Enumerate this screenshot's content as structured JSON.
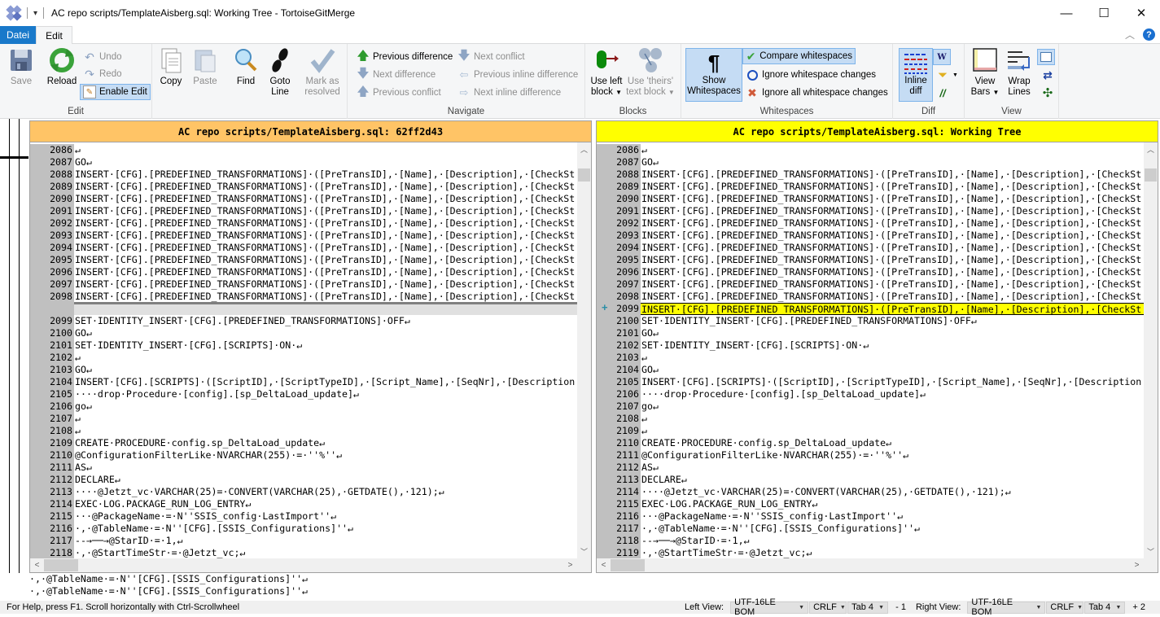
{
  "window": {
    "title": "AC repo scripts/TemplateAisberg.sql: Working Tree - TortoiseGitMerge",
    "controls": {
      "minimize": "—",
      "maximize": "☐",
      "close": "✕"
    }
  },
  "ribbon_tabs": [
    {
      "label": "Datei",
      "active": false
    },
    {
      "label": "Edit",
      "active": true
    }
  ],
  "ribbon": {
    "edit_group": {
      "label": "Edit",
      "save": "Save",
      "reload": "Reload",
      "undo": "Undo",
      "redo": "Redo",
      "enable_edit": "Enable Edit",
      "copy": "Copy",
      "paste": "Paste",
      "find": "Find",
      "goto_line_1": "Goto",
      "goto_line_2": "Line",
      "mark_resolved_1": "Mark as",
      "mark_resolved_2": "resolved"
    },
    "navigate_group": {
      "label": "Navigate",
      "previous_difference": "Previous difference",
      "next_difference": "Next difference",
      "previous_conflict": "Previous conflict",
      "next_conflict": "Next conflict",
      "previous_inline_difference": "Previous inline difference",
      "next_inline_difference": "Next inline difference"
    },
    "blocks_group": {
      "label": "Blocks",
      "use_left_1": "Use left",
      "use_left_2": "block",
      "use_theirs_1": "Use 'theirs'",
      "use_theirs_2": "text block"
    },
    "whitespaces_group": {
      "label": "Whitespaces",
      "show_whitespaces_1": "Show",
      "show_whitespaces_2": "Whitespaces",
      "compare_whitespaces": "Compare whitespaces",
      "ignore_whitespace_changes": "Ignore whitespace changes",
      "ignore_all_whitespace_changes": "Ignore all whitespace changes"
    },
    "diff_group": {
      "label": "Diff",
      "inline_diff_1": "Inline",
      "inline_diff_2": "diff"
    },
    "view_group": {
      "label": "View",
      "view_bars_1": "View",
      "view_bars_2": "Bars",
      "wrap_lines_1": "Wrap",
      "wrap_lines_2": "Lines"
    }
  },
  "left_pane": {
    "header": "AC repo scripts/TemplateAisberg.sql: 62ff2d43",
    "lines": [
      {
        "n": "2086",
        "t": "↵",
        "k": ""
      },
      {
        "n": "2087",
        "t": "GO↵",
        "k": ""
      },
      {
        "n": "2088",
        "t": "INSERT·[CFG].[PREDEFINED_TRANSFORMATIONS]·([PreTransID],·[Name],·[Description],·[CheckSt",
        "k": ""
      },
      {
        "n": "2089",
        "t": "INSERT·[CFG].[PREDEFINED_TRANSFORMATIONS]·([PreTransID],·[Name],·[Description],·[CheckSt",
        "k": ""
      },
      {
        "n": "2090",
        "t": "INSERT·[CFG].[PREDEFINED_TRANSFORMATIONS]·([PreTransID],·[Name],·[Description],·[CheckSt",
        "k": ""
      },
      {
        "n": "2091",
        "t": "INSERT·[CFG].[PREDEFINED_TRANSFORMATIONS]·([PreTransID],·[Name],·[Description],·[CheckSt",
        "k": ""
      },
      {
        "n": "2092",
        "t": "INSERT·[CFG].[PREDEFINED_TRANSFORMATIONS]·([PreTransID],·[Name],·[Description],·[CheckSt",
        "k": ""
      },
      {
        "n": "2093",
        "t": "INSERT·[CFG].[PREDEFINED_TRANSFORMATIONS]·([PreTransID],·[Name],·[Description],·[CheckSt",
        "k": ""
      },
      {
        "n": "2094",
        "t": "INSERT·[CFG].[PREDEFINED_TRANSFORMATIONS]·([PreTransID],·[Name],·[Description],·[CheckSt",
        "k": ""
      },
      {
        "n": "2095",
        "t": "INSERT·[CFG].[PREDEFINED_TRANSFORMATIONS]·([PreTransID],·[Name],·[Description],·[CheckSt",
        "k": ""
      },
      {
        "n": "2096",
        "t": "INSERT·[CFG].[PREDEFINED_TRANSFORMATIONS]·([PreTransID],·[Name],·[Description],·[CheckSt",
        "k": ""
      },
      {
        "n": "2097",
        "t": "INSERT·[CFG].[PREDEFINED_TRANSFORMATIONS]·([PreTransID],·[Name],·[Description],·[CheckSt",
        "k": ""
      },
      {
        "n": "2098",
        "t": "INSERT·[CFG].[PREDEFINED_TRANSFORMATIONS]·([PreTransID],·[Name],·[Description],·[CheckSt",
        "k": "underlined"
      },
      {
        "n": "",
        "t": "",
        "k": "ghost"
      },
      {
        "n": "2099",
        "t": "SET·IDENTITY_INSERT·[CFG].[PREDEFINED_TRANSFORMATIONS]·OFF↵",
        "k": ""
      },
      {
        "n": "2100",
        "t": "GO↵",
        "k": ""
      },
      {
        "n": "2101",
        "t": "SET·IDENTITY_INSERT·[CFG].[SCRIPTS]·ON·↵",
        "k": ""
      },
      {
        "n": "2102",
        "t": "↵",
        "k": ""
      },
      {
        "n": "2103",
        "t": "GO↵",
        "k": ""
      },
      {
        "n": "2104",
        "t": "INSERT·[CFG].[SCRIPTS]·([ScriptID],·[ScriptTypeID],·[Script_Name],·[SeqNr],·[Description",
        "k": ""
      },
      {
        "n": "2105",
        "t": "····drop·Procedure·[config].[sp_DeltaLoad_update]↵",
        "k": ""
      },
      {
        "n": "2106",
        "t": "go↵",
        "k": ""
      },
      {
        "n": "2107",
        "t": "↵",
        "k": ""
      },
      {
        "n": "2108",
        "t": "↵",
        "k": ""
      },
      {
        "n": "2109",
        "t": "CREATE·PROCEDURE·config.sp_DeltaLoad_update↵",
        "k": ""
      },
      {
        "n": "2110",
        "t": "@ConfigurationFilterLike·NVARCHAR(255)·=·''%''↵",
        "k": ""
      },
      {
        "n": "2111",
        "t": "AS↵",
        "k": ""
      },
      {
        "n": "2112",
        "t": "DECLARE↵",
        "k": ""
      },
      {
        "n": "2113",
        "t": "····@Jetzt_vc·VARCHAR(25)=·CONVERT(VARCHAR(25),·GETDATE(),·121);↵",
        "k": ""
      },
      {
        "n": "2114",
        "t": "EXEC·LOG.PACKAGE_RUN_LOG_ENTRY↵",
        "k": ""
      },
      {
        "n": "2115",
        "t": "···@PackageName·=·N''SSIS_config·LastImport''↵",
        "k": ""
      },
      {
        "n": "2116",
        "t": "·,·@TableName·=·N''[CFG].[SSIS_Configurations]''↵",
        "k": ""
      },
      {
        "n": "2117",
        "t": "--→──→@StarID·=·1,↵",
        "k": ""
      },
      {
        "n": "2118",
        "t": "·,·@StartTimeStr·=·@Jetzt_vc;↵",
        "k": ""
      }
    ]
  },
  "right_pane": {
    "header": "AC repo scripts/TemplateAisberg.sql: Working Tree",
    "added_marker": "+",
    "lines": [
      {
        "n": "2086",
        "t": "↵",
        "k": ""
      },
      {
        "n": "2087",
        "t": "GO↵",
        "k": ""
      },
      {
        "n": "2088",
        "t": "INSERT·[CFG].[PREDEFINED_TRANSFORMATIONS]·([PreTransID],·[Name],·[Description],·[CheckSt",
        "k": ""
      },
      {
        "n": "2089",
        "t": "INSERT·[CFG].[PREDEFINED_TRANSFORMATIONS]·([PreTransID],·[Name],·[Description],·[CheckSt",
        "k": ""
      },
      {
        "n": "2090",
        "t": "INSERT·[CFG].[PREDEFINED_TRANSFORMATIONS]·([PreTransID],·[Name],·[Description],·[CheckSt",
        "k": ""
      },
      {
        "n": "2091",
        "t": "INSERT·[CFG].[PREDEFINED_TRANSFORMATIONS]·([PreTransID],·[Name],·[Description],·[CheckSt",
        "k": ""
      },
      {
        "n": "2092",
        "t": "INSERT·[CFG].[PREDEFINED_TRANSFORMATIONS]·([PreTransID],·[Name],·[Description],·[CheckSt",
        "k": ""
      },
      {
        "n": "2093",
        "t": "INSERT·[CFG].[PREDEFINED_TRANSFORMATIONS]·([PreTransID],·[Name],·[Description],·[CheckSt",
        "k": ""
      },
      {
        "n": "2094",
        "t": "INSERT·[CFG].[PREDEFINED_TRANSFORMATIONS]·([PreTransID],·[Name],·[Description],·[CheckSt",
        "k": ""
      },
      {
        "n": "2095",
        "t": "INSERT·[CFG].[PREDEFINED_TRANSFORMATIONS]·([PreTransID],·[Name],·[Description],·[CheckSt",
        "k": ""
      },
      {
        "n": "2096",
        "t": "INSERT·[CFG].[PREDEFINED_TRANSFORMATIONS]·([PreTransID],·[Name],·[Description],·[CheckSt",
        "k": ""
      },
      {
        "n": "2097",
        "t": "INSERT·[CFG].[PREDEFINED_TRANSFORMATIONS]·([PreTransID],·[Name],·[Description],·[CheckSt",
        "k": ""
      },
      {
        "n": "2098",
        "t": "INSERT·[CFG].[PREDEFINED_TRANSFORMATIONS]·([PreTransID],·[Name],·[Description],·[CheckSt",
        "k": ""
      },
      {
        "n": "2099",
        "t": "INSERT·[CFG].[PREDEFINED_TRANSFORMATIONS]·([PreTransID],·[Name],·[Description],·[CheckSt",
        "k": "added"
      },
      {
        "n": "2100",
        "t": "SET·IDENTITY_INSERT·[CFG].[PREDEFINED_TRANSFORMATIONS]·OFF↵",
        "k": ""
      },
      {
        "n": "2101",
        "t": "GO↵",
        "k": ""
      },
      {
        "n": "2102",
        "t": "SET·IDENTITY_INSERT·[CFG].[SCRIPTS]·ON·↵",
        "k": ""
      },
      {
        "n": "2103",
        "t": "↵",
        "k": ""
      },
      {
        "n": "2104",
        "t": "GO↵",
        "k": ""
      },
      {
        "n": "2105",
        "t": "INSERT·[CFG].[SCRIPTS]·([ScriptID],·[ScriptTypeID],·[Script_Name],·[SeqNr],·[Description",
        "k": ""
      },
      {
        "n": "2106",
        "t": "····drop·Procedure·[config].[sp_DeltaLoad_update]↵",
        "k": ""
      },
      {
        "n": "2107",
        "t": "go↵",
        "k": ""
      },
      {
        "n": "2108",
        "t": "↵",
        "k": ""
      },
      {
        "n": "2109",
        "t": "↵",
        "k": ""
      },
      {
        "n": "2110",
        "t": "CREATE·PROCEDURE·config.sp_DeltaLoad_update↵",
        "k": ""
      },
      {
        "n": "2111",
        "t": "@ConfigurationFilterLike·NVARCHAR(255)·=·''%''↵",
        "k": ""
      },
      {
        "n": "2112",
        "t": "AS↵",
        "k": ""
      },
      {
        "n": "2113",
        "t": "DECLARE↵",
        "k": ""
      },
      {
        "n": "2114",
        "t": "····@Jetzt_vc·VARCHAR(25)=·CONVERT(VARCHAR(25),·GETDATE(),·121);↵",
        "k": ""
      },
      {
        "n": "2115",
        "t": "EXEC·LOG.PACKAGE_RUN_LOG_ENTRY↵",
        "k": ""
      },
      {
        "n": "2116",
        "t": "···@PackageName·=·N''SSIS_config·LastImport''↵",
        "k": ""
      },
      {
        "n": "2117",
        "t": "·,·@TableName·=·N''[CFG].[SSIS_Configurations]''↵",
        "k": ""
      },
      {
        "n": "2118",
        "t": "--→──→@StarID·=·1,↵",
        "k": ""
      },
      {
        "n": "2119",
        "t": "·,·@StartTimeStr·=·@Jetzt_vc;↵",
        "k": ""
      }
    ]
  },
  "bottom_view": {
    "lines": [
      "·,·@TableName·=·N''[CFG].[SSIS_Configurations]''↵",
      "·,·@TableName·=·N''[CFG].[SSIS_Configurations]''↵"
    ]
  },
  "statusbar": {
    "help_text": "For Help, press F1. Scroll horizontally with Ctrl-Scrollwheel",
    "left_view_label": "Left View:",
    "left_encoding": "UTF-16LE BOM",
    "left_eol": "CRLF",
    "left_tab": "Tab 4",
    "left_diff_count": "- 1",
    "right_view_label": "Right View:",
    "right_encoding": "UTF-16LE BOM",
    "right_eol": "CRLF",
    "right_tab": "Tab 4",
    "right_diff_count": "+ 2"
  },
  "colors": {
    "left_header": "#ffc466",
    "right_header": "#ffff00",
    "added_line": "#ffff00",
    "file_tab": "#1979ca"
  }
}
